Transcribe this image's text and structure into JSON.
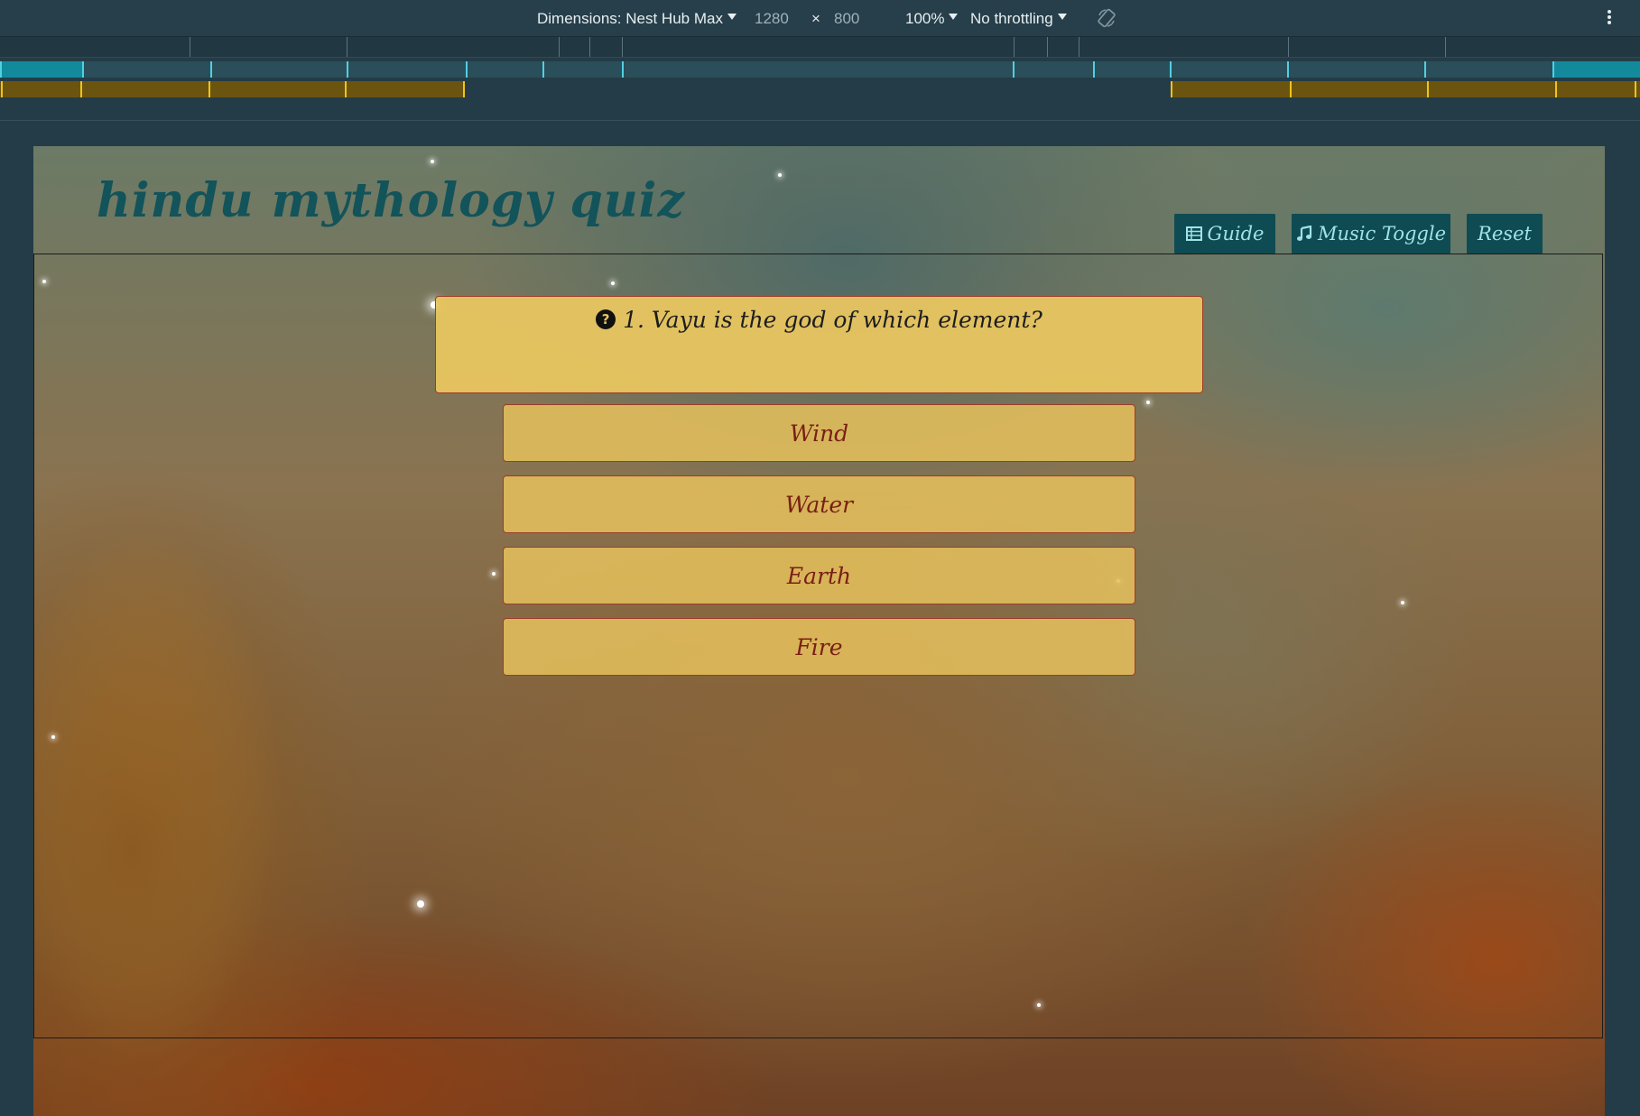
{
  "devtools": {
    "dimensions_label": "Dimensions: Nest Hub Max",
    "width": "1280",
    "times": "×",
    "height": "800",
    "zoom": "100%",
    "throttling": "No throttling",
    "rotate_icon": "rotate-icon",
    "more_icon": "kebab-menu-icon"
  },
  "site": {
    "title": "hindu mythology quiz",
    "nav": {
      "guide": {
        "label": "Guide",
        "icon": "table-icon"
      },
      "music": {
        "label": "Music Toggle",
        "icon": "music-note-icon"
      },
      "reset": {
        "label": "Reset"
      }
    }
  },
  "quiz": {
    "question_icon": "question-circle-icon",
    "question": "1. Vayu is the god of which element?",
    "answers": [
      "Wind",
      "Water",
      "Earth",
      "Fire"
    ]
  },
  "colors": {
    "nav_bg": "#0f4b52",
    "nav_text": "#9fe3e6",
    "title": "#13535a",
    "card_bg": "#e8c560",
    "answer_text": "#7a1f14"
  }
}
